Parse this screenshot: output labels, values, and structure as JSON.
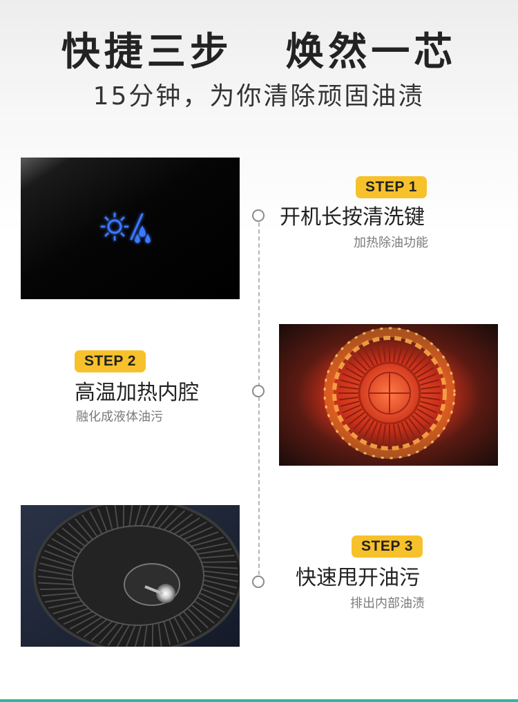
{
  "header": {
    "title": "快捷三步   焕然一芯",
    "subtitle": "15分钟，为你清除顽固油渍"
  },
  "steps": [
    {
      "badge": "STEP 1",
      "title": "开机长按清洗键",
      "desc": "加热除油功能",
      "icon": "sun-slash-drops-icon"
    },
    {
      "badge": "STEP 2",
      "title": "高温加热内腔",
      "desc": "融化成液体油污",
      "icon": "heated-fan-image"
    },
    {
      "badge": "STEP 3",
      "title": "快速甩开油污",
      "desc": "排出内部油渍",
      "icon": "fan-wheel-image"
    }
  ],
  "colors": {
    "accent": "#f7c12b",
    "glow_blue": "#2a66ff",
    "heat_red": "#e0341a",
    "bottom_bar": "#2fb5a5"
  }
}
